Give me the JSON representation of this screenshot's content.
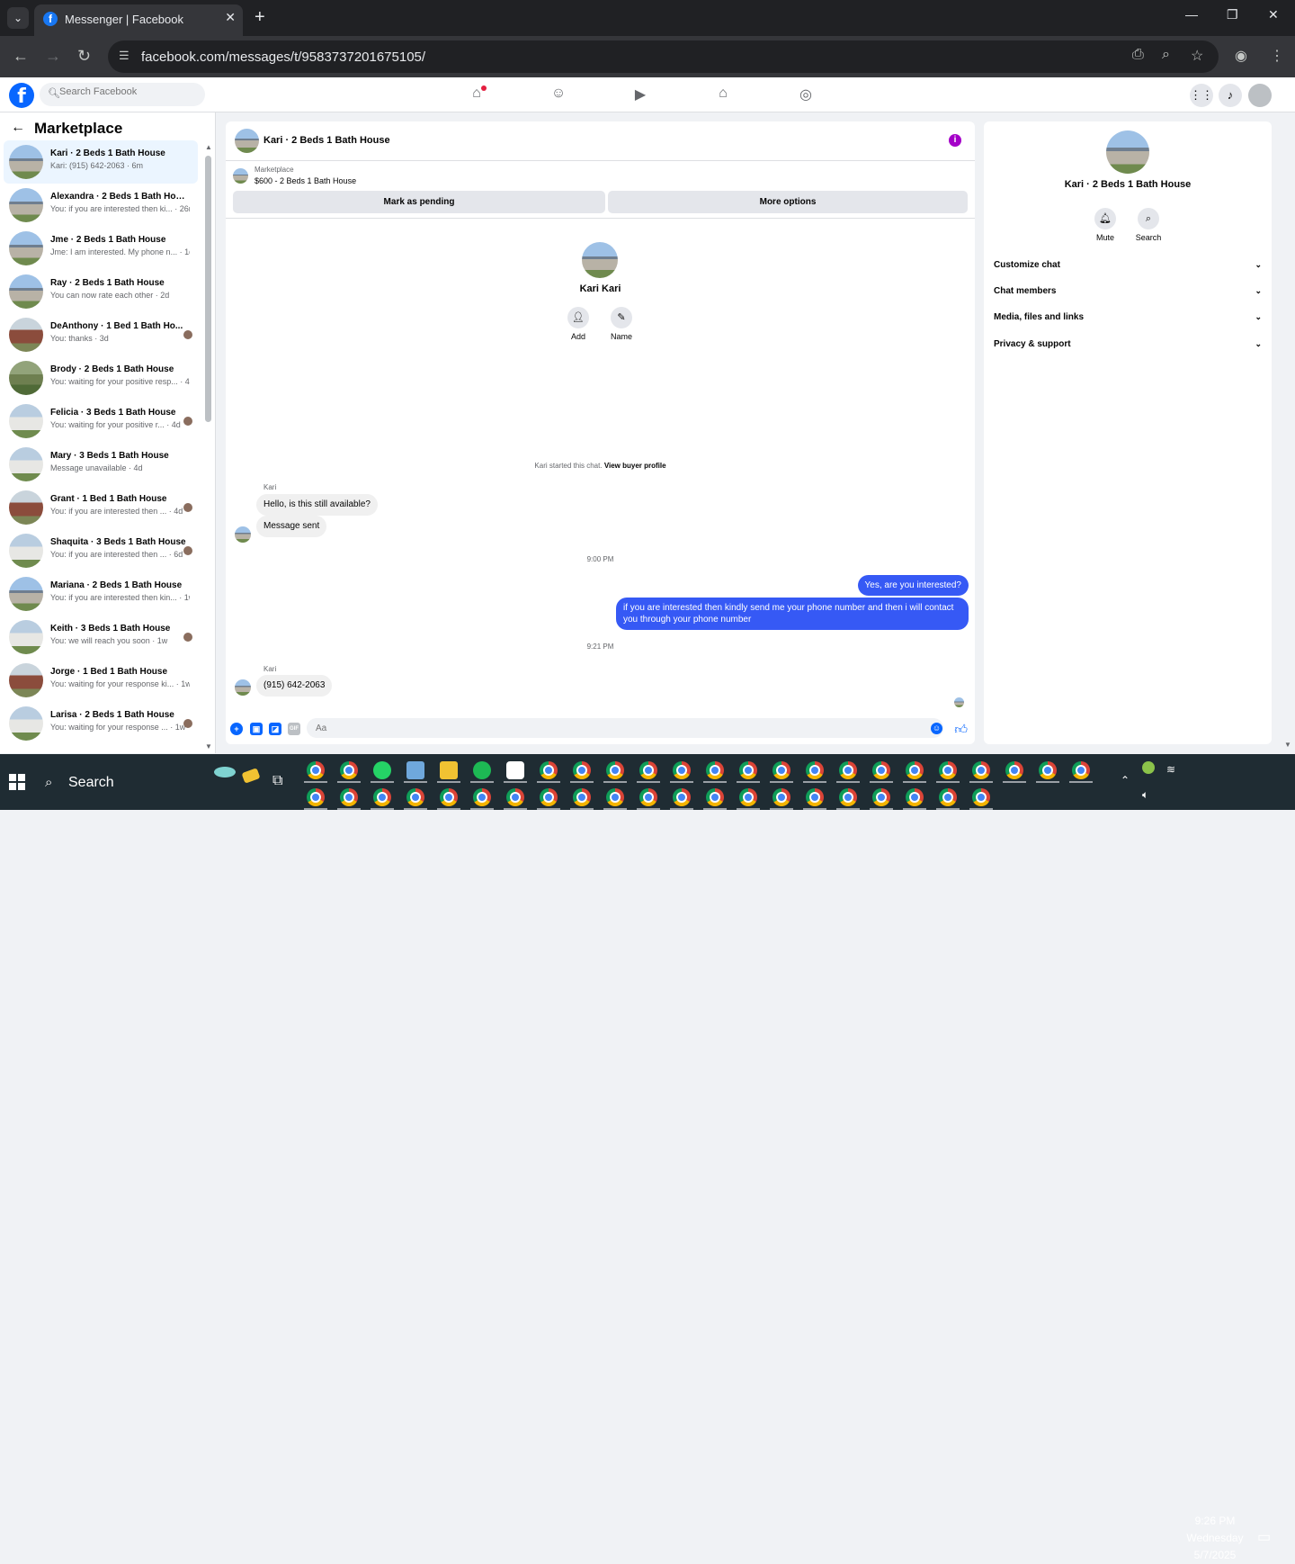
{
  "browser": {
    "tab_title": "Messenger | Facebook",
    "url": "facebook.com/messages/t/9583737201675105/"
  },
  "fb": {
    "search_placeholder": "Search Facebook"
  },
  "left": {
    "title": "Marketplace",
    "conversations": [
      {
        "name": "Kari · 2 Beds 1 Bath House",
        "snippet": "Kari: (915) 642-2063 · 6m",
        "active": true,
        "thumb": "blue-house",
        "mini": false
      },
      {
        "name": "Alexandra · 2 Beds 1 Bath House",
        "snippet": "You: if you are interested then ki... · 26m",
        "active": false,
        "thumb": "blue-house",
        "mini": false
      },
      {
        "name": "Jme · 2 Beds 1 Bath House",
        "snippet": "Jme: I am interested. My phone n... · 1d",
        "active": false,
        "thumb": "blue-house",
        "mini": false
      },
      {
        "name": "Ray · 2 Beds 1 Bath House",
        "snippet": "You can now rate each other · 2d",
        "active": false,
        "thumb": "blue-house",
        "mini": false
      },
      {
        "name": "DeAnthony · 1 Bed 1 Bath Ho...",
        "snippet": "You: thanks · 3d",
        "active": false,
        "thumb": "red-house",
        "mini": true
      },
      {
        "name": "Brody · 2 Beds 1 Bath House",
        "snippet": "You: waiting for your positive resp... · 4d",
        "active": false,
        "thumb": "green-house",
        "mini": false
      },
      {
        "name": "Felicia · 3 Beds 1 Bath House",
        "snippet": "You: waiting for your positive r... · 4d",
        "active": false,
        "thumb": "white-house",
        "mini": true
      },
      {
        "name": "Mary · 3 Beds 1 Bath House",
        "snippet": "Message unavailable · 4d",
        "active": false,
        "thumb": "white-house",
        "mini": false
      },
      {
        "name": "Grant · 1 Bed 1 Bath House",
        "snippet": "You: if you are interested then ... · 4d",
        "active": false,
        "thumb": "red-house",
        "mini": true
      },
      {
        "name": "Shaquita · 3 Beds 1 Bath House",
        "snippet": "You: if you are interested then ... · 6d",
        "active": false,
        "thumb": "white-house",
        "mini": true
      },
      {
        "name": "Mariana · 2 Beds 1 Bath House",
        "snippet": "You: if you are interested then kin... · 1w",
        "active": false,
        "thumb": "blue-house",
        "mini": false
      },
      {
        "name": "Keith · 3 Beds 1 Bath House",
        "snippet": "You: we will reach you soon · 1w",
        "active": false,
        "thumb": "white-house",
        "mini": true
      },
      {
        "name": "Jorge · 1 Bed 1 Bath House",
        "snippet": "You: waiting for your response ki... · 1w",
        "active": false,
        "thumb": "red-house",
        "mini": false
      },
      {
        "name": "Larisa · 2 Beds 1 Bath House",
        "snippet": "You: waiting for your response ... · 1w",
        "active": false,
        "thumb": "white-house",
        "mini": true
      }
    ]
  },
  "chat": {
    "title": "Kari · 2 Beds 1 Bath House",
    "marketplace_label": "Marketplace",
    "listing": "$600 - 2 Beds 1 Bath House",
    "btn_pending": "Mark as pending",
    "btn_more": "More options",
    "profile_name": "Kari Kari",
    "add_label": "Add",
    "name_label": "Name",
    "started_text": "Kari started this chat.",
    "view_buyer": "View buyer profile",
    "sender1": "Kari",
    "msg1": "Hello, is this still available?",
    "msg2": "Message sent",
    "time1": "9:00 PM",
    "out1": "Yes, are you interested?",
    "out2": "if you are interested then kindly send me your phone number and then i will contact you through your phone number",
    "time2": "9:21 PM",
    "sender2": "Kari",
    "msg3": "(915) 642-2063",
    "input_placeholder": "Aa"
  },
  "right": {
    "name": "Kari · 2 Beds 1 Bath House",
    "mute": "Mute",
    "search": "Search",
    "sections": [
      "Customize chat",
      "Chat members",
      "Media, files and links",
      "Privacy & support"
    ]
  },
  "taskbar": {
    "search_label": "Search",
    "time": "9:26 PM",
    "day": "Wednesday",
    "date": "5/7/2025"
  },
  "colors": {
    "accent": "#0866ff",
    "outgoing_bubble": "#3659f5",
    "info": "#a400c8"
  }
}
